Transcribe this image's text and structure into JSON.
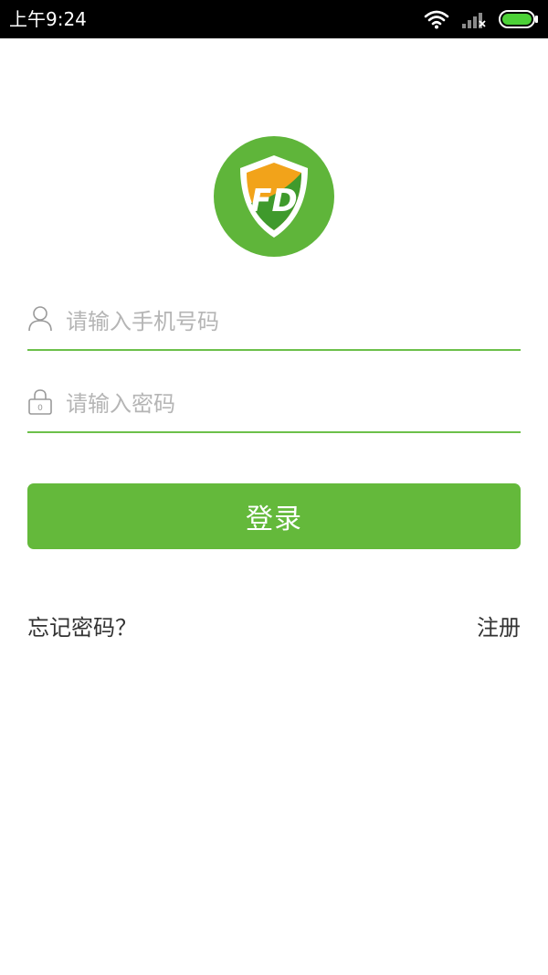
{
  "status_bar": {
    "time": "上午9:24"
  },
  "login_form": {
    "phone_placeholder": "请输入手机号码",
    "password_placeholder": "请输入密码",
    "lock_glyph": "0",
    "login_label": "登录"
  },
  "links": {
    "forgot_password": "忘记密码？",
    "register": "注册"
  },
  "logo": {
    "letters": "FD"
  },
  "colors": {
    "accent": "#64b93b",
    "underline": "#6cc04a",
    "logo_circle": "#5fb53a",
    "shield_orange": "#f2a31a",
    "shield_green": "#3f9a2c"
  },
  "icons": {
    "phone_field": "user-icon",
    "password_field": "lock-icon",
    "status": [
      "wifi-icon",
      "signal-icon",
      "battery-icon"
    ]
  }
}
